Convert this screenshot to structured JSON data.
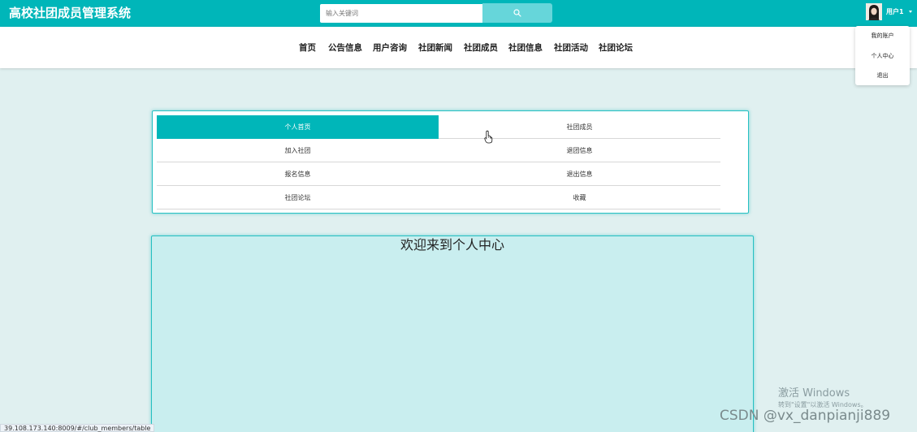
{
  "header": {
    "title": "高校社团成员管理系统",
    "search_placeholder": "输入关键词",
    "user_name": "用户1"
  },
  "nav": {
    "items": [
      "首页",
      "公告信息",
      "用户咨询",
      "社团新闻",
      "社团成员",
      "社团信息",
      "社团活动",
      "社团论坛"
    ]
  },
  "user_menu": {
    "items": [
      "我的账户",
      "个人中心",
      "退出"
    ]
  },
  "center_menu": {
    "items": [
      "个人首页",
      "社团成员",
      "加入社团",
      "退团信息",
      "报名信息",
      "退出信息",
      "社团论坛",
      "收藏"
    ],
    "active": "个人首页"
  },
  "welcome": {
    "title": "欢迎来到个人中心"
  },
  "status_bar": {
    "url": "39.108.173.140:8009/#/club_members/table"
  },
  "os_overlay": {
    "activate_title": "激活 Windows",
    "activate_sub": "转到\"设置\"以激活 Windows。",
    "watermark": "CSDN @vx_danpianji889"
  },
  "colors": {
    "primary": "#00b6b9",
    "search_button": "#66d6da",
    "page_background": "#e0f0f0",
    "welcome_background": "#c9eeef"
  }
}
